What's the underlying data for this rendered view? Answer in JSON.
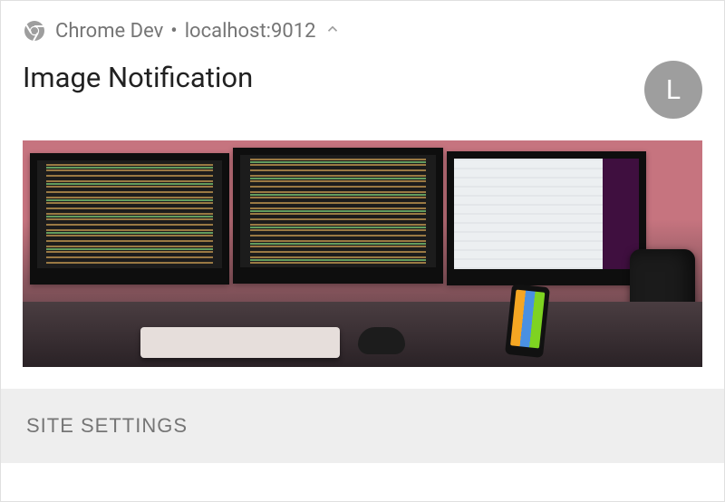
{
  "header": {
    "app_name": "Chrome Dev",
    "separator": "•",
    "origin": "localhost:9012"
  },
  "notification": {
    "title": "Image Notification",
    "avatar_letter": "L"
  },
  "actions": {
    "site_settings": "SITE SETTINGS"
  }
}
